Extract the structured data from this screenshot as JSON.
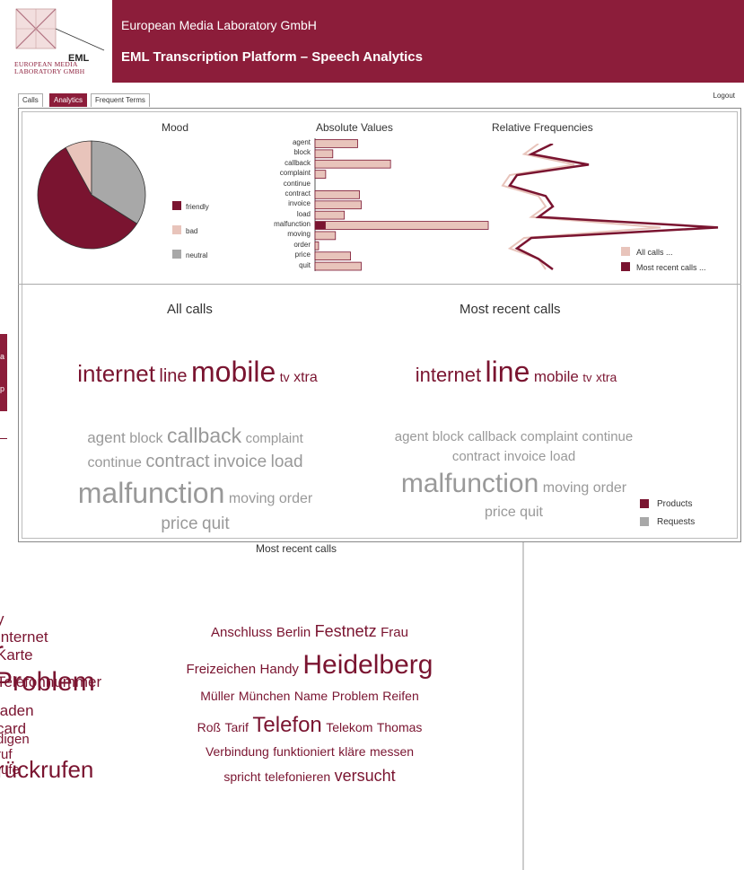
{
  "header": {
    "org": "European Media Laboratory GmbH",
    "title": "EML Transcription Platform – Speech Analytics",
    "logo_letters": "EML",
    "logo_sub1": "European Media",
    "logo_sub2": "Laboratory GmbH"
  },
  "tabs": [
    {
      "label": "Calls"
    },
    {
      "label": "Analytics"
    },
    {
      "label": "Frequent Terms"
    }
  ],
  "logout": "Logout",
  "mood": {
    "title": "Mood",
    "legend": [
      "friendly",
      "bad",
      "neutral"
    ],
    "colors": {
      "friendly": "#7a1430",
      "bad": "#e8c4bb",
      "neutral": "#a8a8a8"
    }
  },
  "absolute": {
    "title": "Absolute Values"
  },
  "relative": {
    "title": "Relative Frequencies",
    "legend": [
      "All calls ...",
      "Most recent calls ..."
    ]
  },
  "chart_data": [
    {
      "type": "pie",
      "title": "Mood",
      "categories": [
        "friendly",
        "bad",
        "neutral"
      ],
      "values": [
        58,
        8,
        34
      ]
    },
    {
      "type": "bar",
      "title": "Absolute Values",
      "categories": [
        "agent",
        "block",
        "callback",
        "complaint",
        "continue",
        "contract",
        "invoice",
        "load",
        "malfunction",
        "moving",
        "order",
        "price",
        "quit"
      ],
      "series": [
        {
          "name": "All calls",
          "values": [
            48,
            20,
            85,
            12,
            0,
            50,
            52,
            33,
            195,
            23,
            4,
            40,
            52
          ]
        },
        {
          "name": "Most recent calls",
          "values": [
            0,
            0,
            0,
            0,
            0,
            0,
            0,
            0,
            12,
            0,
            0,
            0,
            0
          ]
        }
      ]
    },
    {
      "type": "line",
      "title": "Relative Frequencies",
      "categories": [
        "agent",
        "block",
        "callback",
        "complaint",
        "continue",
        "contract",
        "invoice",
        "load",
        "malfunction",
        "moving",
        "order",
        "price",
        "quit"
      ],
      "series": [
        {
          "name": "All calls ...",
          "values": [
            5,
            3,
            10,
            1,
            0,
            5,
            6,
            4,
            22,
            3,
            1,
            5,
            6
          ]
        },
        {
          "name": "Most recent calls ...",
          "values": [
            7,
            4,
            12,
            2,
            1,
            6,
            7,
            5,
            30,
            4,
            2,
            5,
            7
          ]
        }
      ]
    }
  ],
  "all_calls": {
    "title": "All calls",
    "products": [
      "internet",
      "line",
      "mobile",
      "tv",
      "xtra"
    ],
    "requests": [
      "agent",
      "block",
      "callback",
      "complaint",
      "continue",
      "contract",
      "invoice",
      "load",
      "malfunction",
      "moving",
      "order",
      "price",
      "quit"
    ]
  },
  "recent_calls": {
    "title": "Most recent calls",
    "products": [
      "internet",
      "line",
      "mobile",
      "tv",
      "xtra"
    ],
    "requests": [
      "agent",
      "block",
      "callback",
      "complaint",
      "continue",
      "contract",
      "invoice",
      "load",
      "malfunction",
      "moving",
      "order",
      "price",
      "quit"
    ]
  },
  "cloud_legend": [
    "Products",
    "Requests"
  ],
  "background": {
    "recent_title": "Most recent calls",
    "cloud_words": [
      "Anschluss",
      "Berlin",
      "Festnetz",
      "Frau",
      "Freizeichen",
      "Handy",
      "Heidelberg",
      "Müller",
      "München",
      "Name",
      "Problem",
      "Reifen",
      "Roß",
      "Tarif",
      "Telefon",
      "Telekom",
      "Thomas",
      "Verbindung",
      "funktioniert",
      "kläre",
      "messen",
      "spricht",
      "telefonieren",
      "versucht"
    ],
    "left_fragments": [
      "y Internet Karte",
      "r Problem",
      "Telefonnummer",
      "laden card",
      "digen ruf rufe",
      "rückrufen"
    ],
    "left_box": [
      "a",
      "p"
    ]
  }
}
